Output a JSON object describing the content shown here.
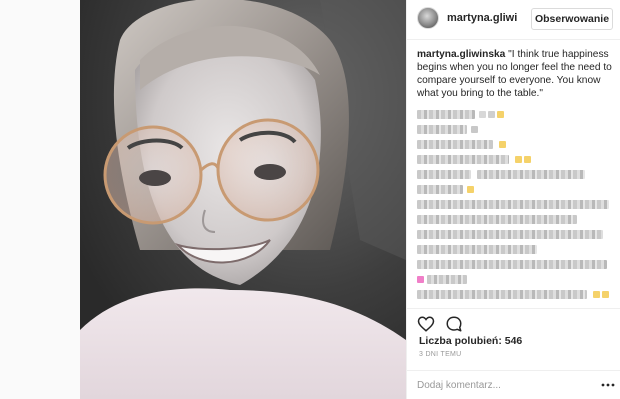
{
  "post": {
    "header": {
      "username": "martyna.gliwi",
      "follow_label": "Obserwowanie"
    },
    "caption": {
      "username": "martyna.gliwinska",
      "text": "\"I think true happiness begins when you no longer feel the need to compare yourself to everyone. You know what you bring to the table.\""
    },
    "likes_label": "Liczba polubień: 546",
    "timestamp": "3 DNI TEMU",
    "comment_placeholder": "Dodaj komentarz...",
    "icons": [
      "heart-icon",
      "comment-icon",
      "more-options-icon"
    ],
    "colors": {
      "accent_text": "#262626",
      "muted_text": "#999999",
      "border": "#efefef",
      "emoji_yellow": "#f5d26a",
      "emoji_pink": "#f07fc8"
    }
  }
}
